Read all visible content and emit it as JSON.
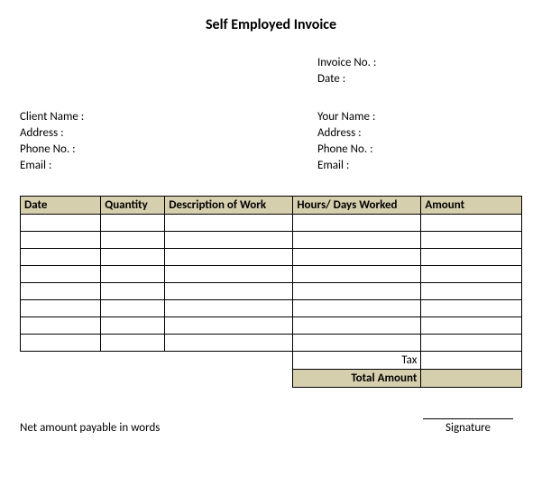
{
  "title": "Self Employed Invoice",
  "meta": {
    "invoice_no_label": "Invoice No. :",
    "date_label": "Date :"
  },
  "client": {
    "name_label": "Client Name :",
    "address_label": "Address :",
    "phone_label": "Phone No. :",
    "email_label": "Email :"
  },
  "self": {
    "name_label": "Your Name :",
    "address_label": "Address :",
    "phone_label": "Phone No. :",
    "email_label": "Email :"
  },
  "table": {
    "headers": {
      "date": "Date",
      "quantity": "Quantity",
      "description": "Description of Work",
      "hours": "Hours/ Days Worked",
      "amount": "Amount"
    },
    "tax_label": "Tax",
    "total_label": "Total Amount"
  },
  "footer": {
    "net_words": "Net amount payable in words",
    "signature": "Signature"
  }
}
